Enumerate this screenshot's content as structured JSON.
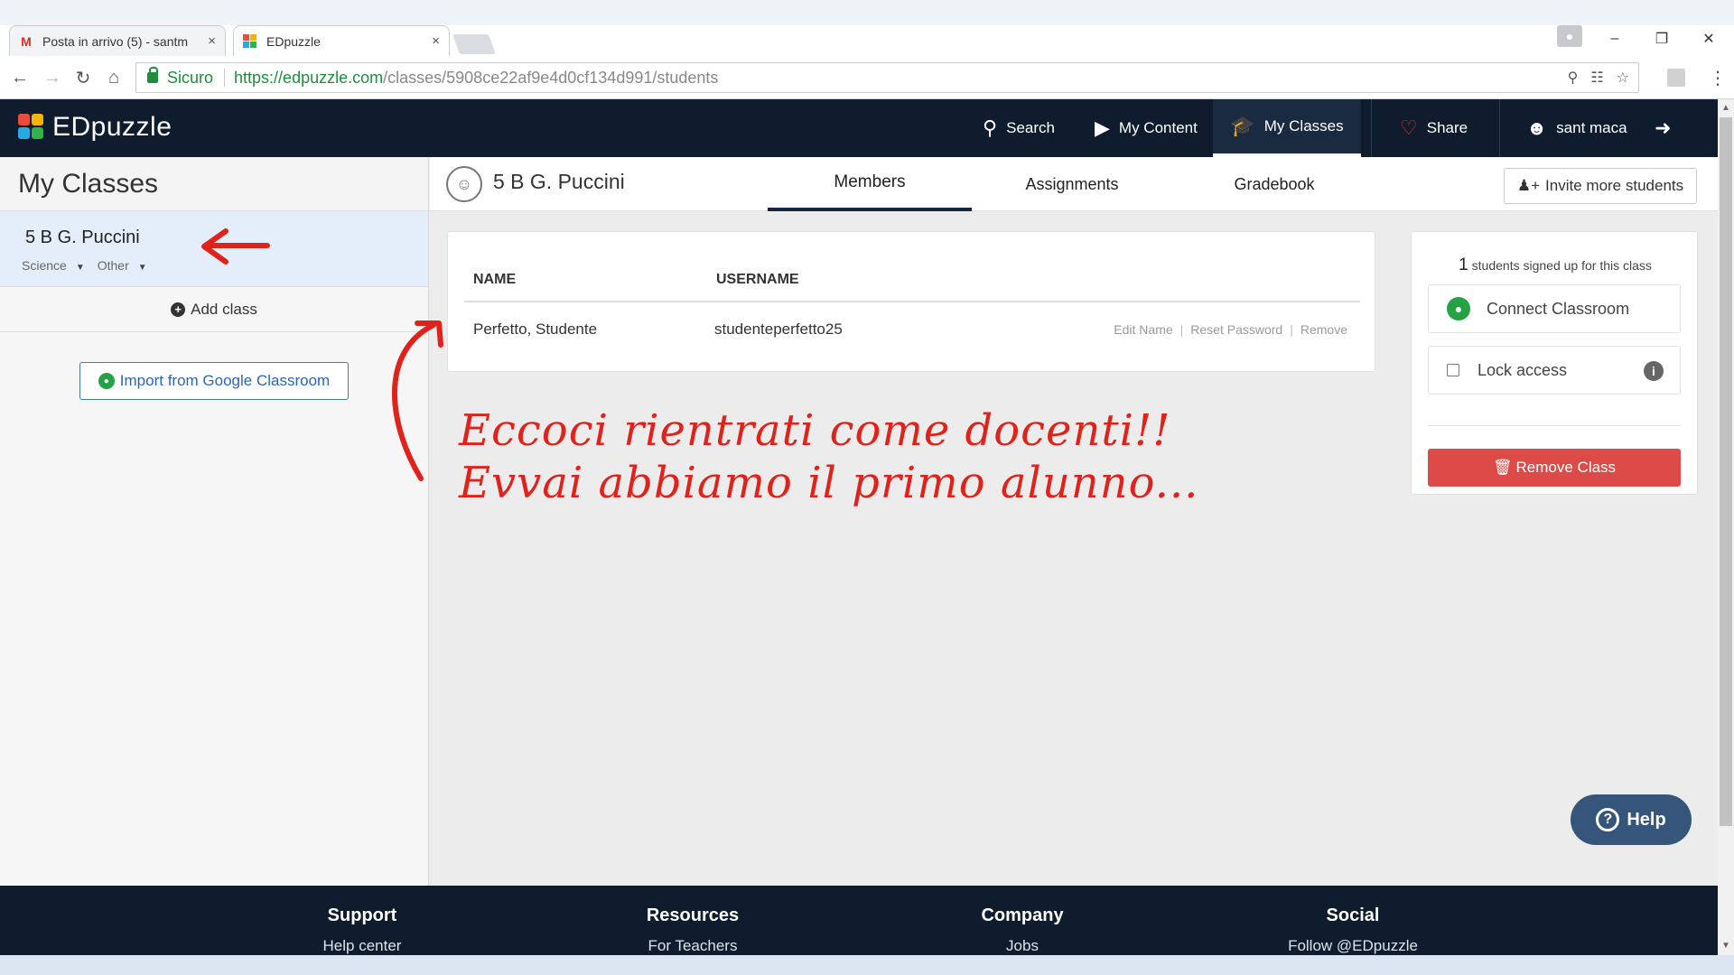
{
  "browser": {
    "tabs": [
      {
        "label": "Posta in arrivo (5) - santm",
        "close": "×"
      },
      {
        "label": "EDpuzzle",
        "close": "×"
      }
    ],
    "secure_label": "Sicuro",
    "url_host": "https://edpuzzle.com",
    "url_path": "/classes/5908ce22af9e4d0cf134d991/students",
    "window_controls": [
      "–",
      "❐",
      "✕"
    ]
  },
  "app": {
    "brand": "EDpuzzle",
    "nav": {
      "search": "Search",
      "my_content": "My Content",
      "my_classes": "My Classes",
      "share": "Share",
      "user": "sant maca"
    }
  },
  "sidebar": {
    "title": "My Classes",
    "classes": [
      {
        "name": "5 B G. Puccini",
        "subject": "Science",
        "grade": "Other"
      }
    ],
    "add_class": "Add class",
    "import_google": "Import from Google Classroom"
  },
  "class_header": {
    "title": "5 B G. Puccini",
    "tabs": [
      "Members",
      "Assignments",
      "Gradebook"
    ],
    "active_tab": "Members",
    "invite": "Invite more students"
  },
  "members_table": {
    "columns": [
      "NAME",
      "USERNAME"
    ],
    "rows": [
      {
        "name": "Perfetto, Studente",
        "username": "studenteperfetto25",
        "actions": [
          "Edit Name",
          "Reset Password",
          "Remove"
        ]
      }
    ]
  },
  "class_panel": {
    "student_count": "1",
    "signed_label": "students signed up for this class",
    "connect": "Connect Classroom",
    "lock_access": "Lock access",
    "remove_class": "Remove Class"
  },
  "annotation": {
    "line1": "Eccoci rientrati come docenti!!",
    "line2": "Evvai abbiamo il primo alunno..."
  },
  "footer": {
    "columns": [
      {
        "heading": "Support",
        "link": "Help center"
      },
      {
        "heading": "Resources",
        "link": "For Teachers"
      },
      {
        "heading": "Company",
        "link": "Jobs"
      },
      {
        "heading": "Social",
        "link": "Follow @EDpuzzle"
      }
    ],
    "help": "Help"
  },
  "colors": {
    "nav_bg": "#0f1c2e",
    "accent_red": "#dd4b48",
    "annotation_red": "#e0221b",
    "link_blue": "#2c66b8"
  }
}
